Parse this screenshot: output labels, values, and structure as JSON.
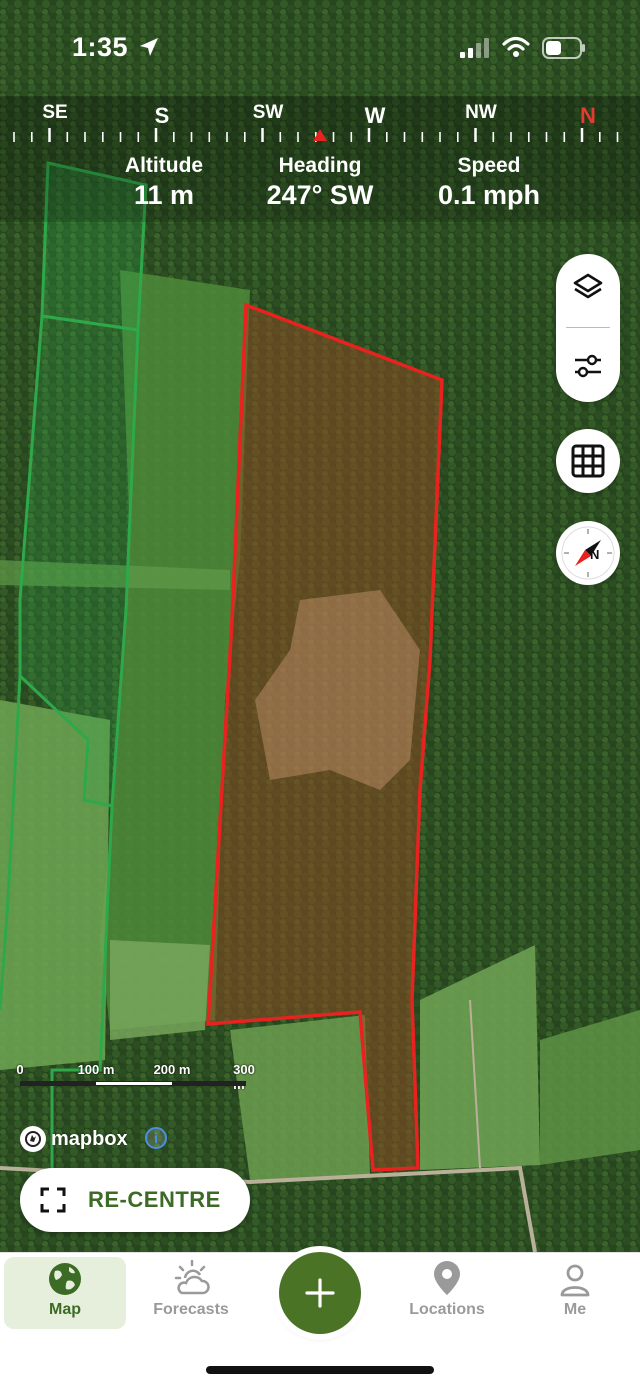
{
  "status_bar": {
    "time": "1:35"
  },
  "compass": {
    "labels": [
      "SE",
      "S",
      "SW",
      "W",
      "NW",
      "N"
    ]
  },
  "telemetry": {
    "altitude": {
      "label": "Altitude",
      "value": "11 m"
    },
    "heading": {
      "label": "Heading",
      "value": "247° SW"
    },
    "speed": {
      "label": "Speed",
      "value": "0.1 mph"
    }
  },
  "map": {
    "scale": {
      "labels": [
        "0",
        "100 m",
        "200 m",
        "300 m"
      ]
    },
    "attribution": "mapbox",
    "colors": {
      "selected_boundary": "#e8231f",
      "other_boundary": "#2ea84a"
    }
  },
  "controls": {
    "layers_icon": "layers-icon",
    "filter_icon": "sliders-icon",
    "grid_icon": "grid-icon",
    "compass_icon": "compass-icon"
  },
  "recentre": {
    "label": "RE-CENTRE"
  },
  "tabs": [
    {
      "label": "Map",
      "icon": "globe-icon",
      "active": true
    },
    {
      "label": "Forecasts",
      "icon": "partly-cloudy-icon",
      "active": false
    },
    {
      "label": "Locations",
      "icon": "location-pin-icon",
      "active": false
    },
    {
      "label": "Me",
      "icon": "person-icon",
      "active": false
    }
  ],
  "accent_color": "#4a7326"
}
